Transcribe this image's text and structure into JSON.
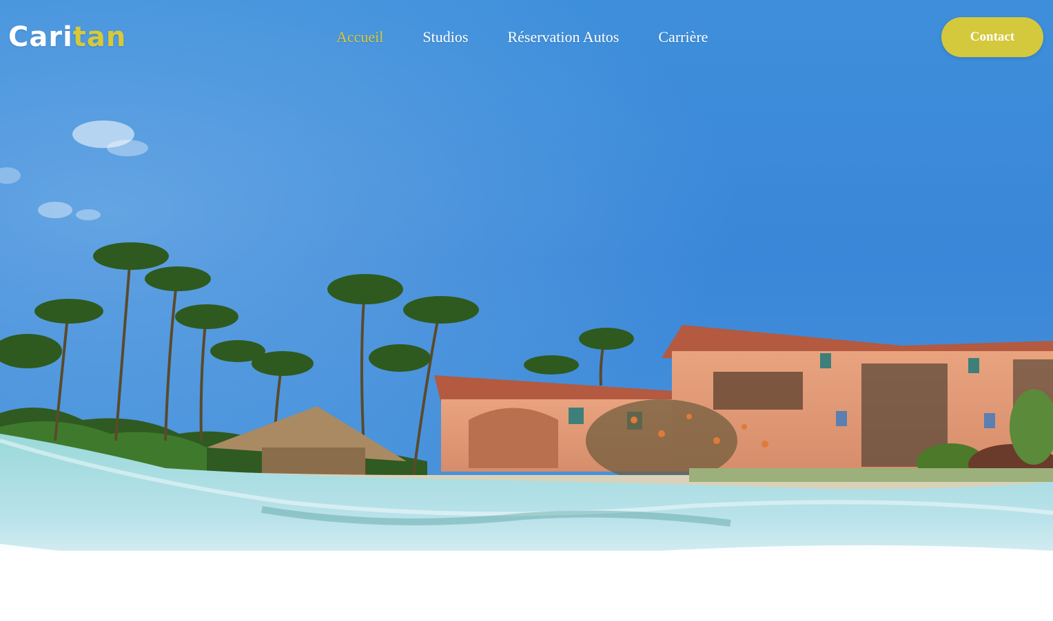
{
  "brand": {
    "logo_part1": "Cari",
    "logo_part2": "tan",
    "accent_color": "#d6c93a"
  },
  "nav": {
    "items": [
      {
        "label": "Accueil",
        "active": true
      },
      {
        "label": "Studios",
        "active": false
      },
      {
        "label": "Réservation Autos",
        "active": false
      },
      {
        "label": "Carrière",
        "active": false
      }
    ]
  },
  "contact": {
    "label": "Contact"
  },
  "colors": {
    "sky_top": "#3d8fdc",
    "button": "#d4c93c"
  }
}
